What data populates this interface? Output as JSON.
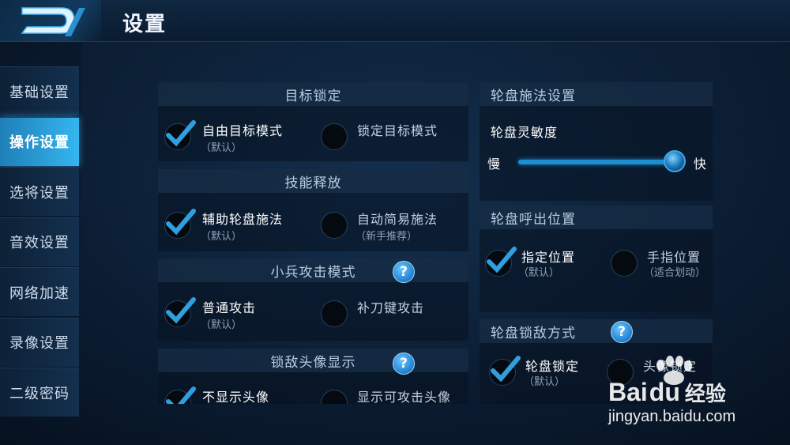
{
  "header": {
    "title": "设置"
  },
  "sidebar": {
    "items": [
      {
        "label": "基础设置",
        "active": false
      },
      {
        "label": "操作设置",
        "active": true
      },
      {
        "label": "选将设置",
        "active": false
      },
      {
        "label": "音效设置",
        "active": false
      },
      {
        "label": "网络加速",
        "active": false
      },
      {
        "label": "录像设置",
        "active": false
      },
      {
        "label": "二级密码",
        "active": false
      }
    ]
  },
  "left": {
    "target_lock": {
      "title": "目标锁定",
      "opt1": {
        "label": "自由目标模式",
        "sub": "（默认）",
        "checked": true
      },
      "opt2": {
        "label": "锁定目标模式",
        "checked": false
      }
    },
    "skill_release": {
      "title": "技能释放",
      "opt1": {
        "label": "辅助轮盘施法",
        "sub": "（默认）",
        "checked": true
      },
      "opt2": {
        "label": "自动简易施法",
        "sub": "（新手推荐）",
        "checked": false
      }
    },
    "minion_attack": {
      "title": "小兵攻击模式",
      "help": "?",
      "opt1": {
        "label": "普通攻击",
        "sub": "（默认）",
        "checked": true
      },
      "opt2": {
        "label": "补刀键攻击",
        "checked": false
      }
    },
    "enemy_avatar": {
      "title": "锁敌头像显示",
      "help": "?",
      "opt1": {
        "label": "不显示头像",
        "checked": true
      },
      "opt2": {
        "label": "显示可攻击头像",
        "checked": false
      }
    }
  },
  "right": {
    "wheel_cast": {
      "title": "轮盘施法设置",
      "sensitivity_label": "轮盘灵敏度",
      "slow": "慢",
      "fast": "快",
      "sensitivity_value": 1.0
    },
    "wheel_position": {
      "title": "轮盘呼出位置",
      "opt1": {
        "label": "指定位置",
        "sub": "（默认）",
        "checked": true
      },
      "opt2": {
        "label": "手指位置",
        "sub": "（适合划动）",
        "checked": false
      }
    },
    "wheel_lock": {
      "title": "轮盘锁敌方式",
      "help": "?",
      "opt1": {
        "label": "轮盘锁定",
        "sub": "（默认）",
        "checked": true
      },
      "opt2": {
        "label": "头像锁定",
        "checked": false
      }
    }
  },
  "watermark": {
    "brand": "Bai",
    "brand2": "du",
    "jy": "经验",
    "url": "jingyan.baidu.com"
  },
  "colors": {
    "accent": "#35b6f0",
    "check": "#2f9fe0"
  }
}
